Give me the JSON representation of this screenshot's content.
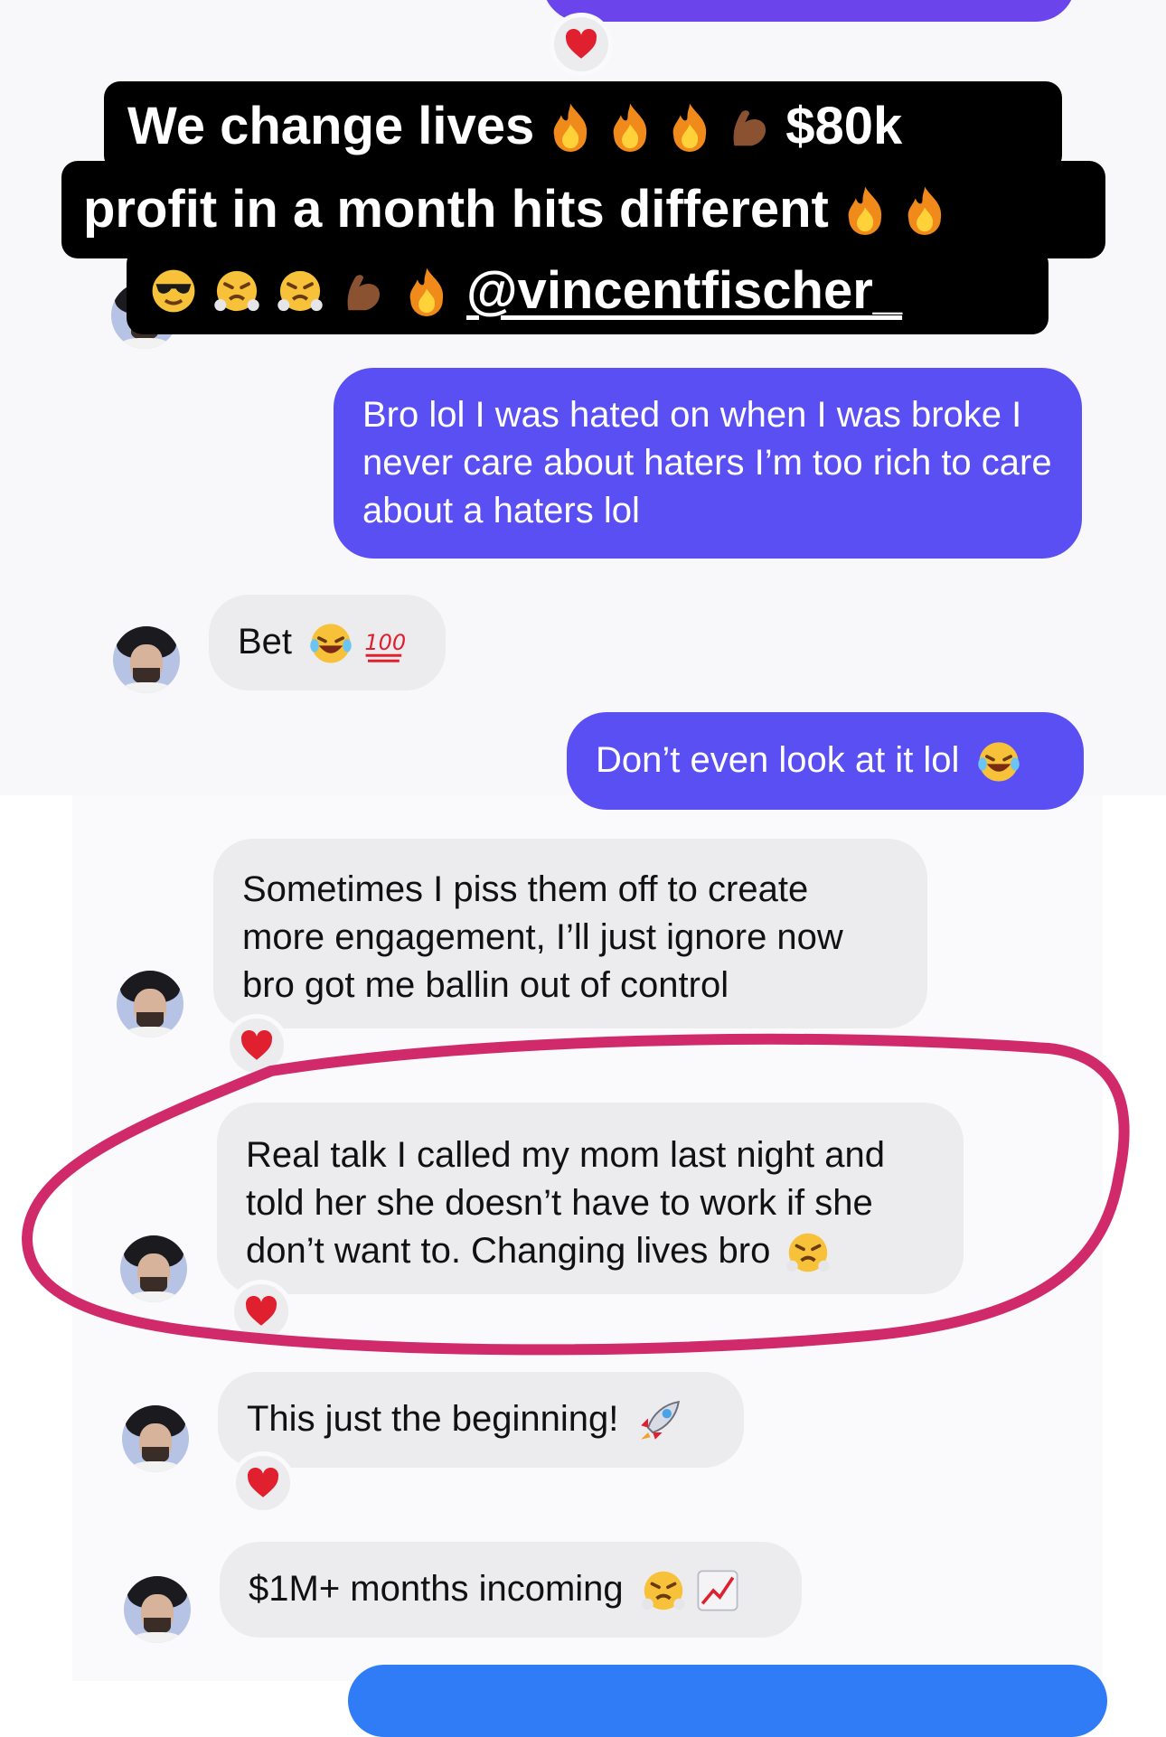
{
  "overlay": {
    "line1_text": "We change lives",
    "line1_amount": "$80k",
    "line2_text": "profit in a month hits different",
    "mention": "@vincentfischer_"
  },
  "messages": [
    {
      "side": "outgoing",
      "text": "Bro lol I was hated on when I was broke I never care about haters I’m too rich to care about a haters lol"
    },
    {
      "side": "incoming",
      "text": "Bet"
    },
    {
      "side": "outgoing",
      "text": "Don’t even look at it lol"
    },
    {
      "side": "incoming",
      "text": "Sometimes I piss them off to create more engagement, I’ll just ignore now bro got me ballin out of control"
    },
    {
      "side": "incoming",
      "text": "Real talk I called my mom last night and told her she doesn’t have to work if she don’t want to. Changing lives bro"
    },
    {
      "side": "incoming",
      "text": "This just the beginning!"
    },
    {
      "side": "incoming",
      "text": "$1M+ months incoming"
    }
  ],
  "colors": {
    "outgoing_bubble": "#5a4ff2",
    "incoming_bubble": "#ececef",
    "highlight_circle": "#d02a6a",
    "heart": "#e0202e"
  },
  "icons": [
    "heart-reaction-icon",
    "fire-emoji",
    "flexed-biceps-emoji",
    "sunglasses-emoji",
    "steam-face-emoji",
    "laughing-tears-emoji",
    "hundred-points-emoji",
    "rocket-emoji",
    "chart-increasing-emoji"
  ]
}
